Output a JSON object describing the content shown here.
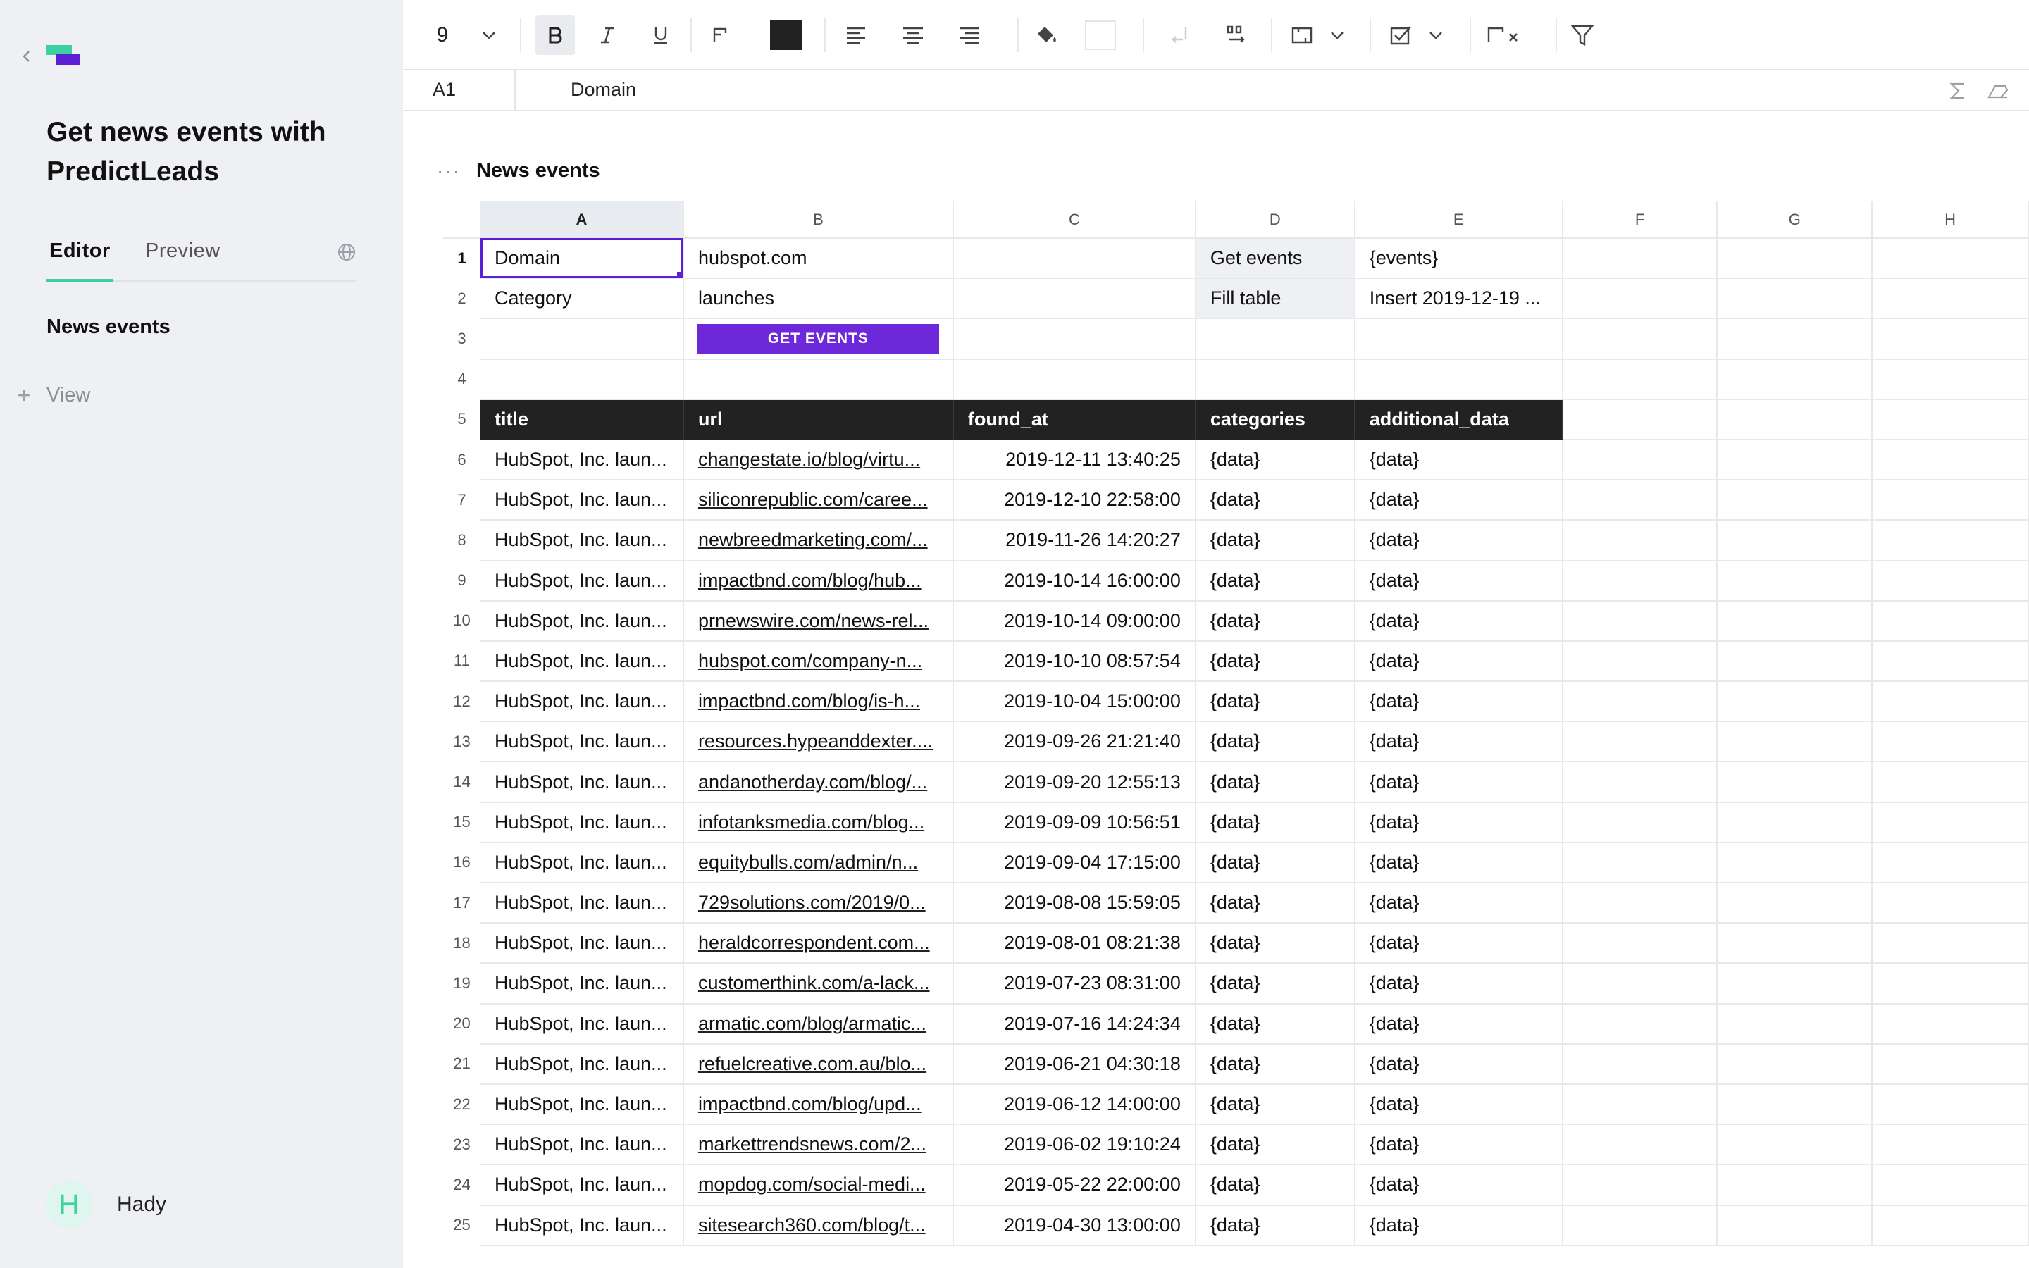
{
  "sidebar": {
    "title": "Get news events with PredictLeads",
    "tabs": [
      {
        "label": "Editor",
        "active": true
      },
      {
        "label": "Preview",
        "active": false
      }
    ],
    "items": [
      {
        "label": "News events"
      }
    ],
    "add_view_label": "View",
    "user": {
      "initial": "H",
      "name": "Hady"
    },
    "icons": [
      "back-chevron-icon",
      "app-logo",
      "globe-icon",
      "plus-icon"
    ]
  },
  "toolbar": {
    "font_size": "9",
    "icons": [
      "chevron-down-icon",
      "bold-icon",
      "italic-icon",
      "underline-icon",
      "text-color-icon",
      "align-left-icon",
      "align-center-icon",
      "align-right-icon",
      "fill-color-icon",
      "indent-icon",
      "outdent-icon",
      "format-icon",
      "checkbox-icon",
      "clear-format-icon",
      "filter-icon"
    ]
  },
  "formula_bar": {
    "cell_ref": "A1",
    "value": "Domain",
    "icons": [
      "sigma-icon",
      "eraser-icon"
    ]
  },
  "sheet": {
    "title": "News events",
    "column_headers": [
      "A",
      "B",
      "C",
      "D",
      "E",
      "F",
      "G",
      "H"
    ],
    "rows": {
      "r1": {
        "a": "Domain",
        "b": "hubspot.com",
        "d": "Get events",
        "e": "{events}"
      },
      "r2": {
        "a": "Category",
        "b": "launches",
        "d": "Fill table",
        "e": "Insert 2019-12-19 ..."
      },
      "r3": {
        "button": "GET EVENTS"
      }
    },
    "table_headers": [
      "title",
      "url",
      "found_at",
      "categories",
      "additional_data"
    ],
    "data_rows": [
      {
        "row": "6",
        "title": "HubSpot, Inc. laun...",
        "url": "changestate.io/blog/virtu...",
        "found_at": "2019-12-11 13:40:25",
        "categories": "{data}",
        "additional_data": "{data}"
      },
      {
        "row": "7",
        "title": "HubSpot, Inc. laun...",
        "url": "siliconrepublic.com/caree...",
        "found_at": "2019-12-10 22:58:00",
        "categories": "{data}",
        "additional_data": "{data}"
      },
      {
        "row": "8",
        "title": "HubSpot, Inc. laun...",
        "url": "newbreedmarketing.com/...",
        "found_at": "2019-11-26 14:20:27",
        "categories": "{data}",
        "additional_data": "{data}"
      },
      {
        "row": "9",
        "title": "HubSpot, Inc. laun...",
        "url": "impactbnd.com/blog/hub...",
        "found_at": "2019-10-14 16:00:00",
        "categories": "{data}",
        "additional_data": "{data}"
      },
      {
        "row": "10",
        "title": "HubSpot, Inc. laun...",
        "url": "prnewswire.com/news-rel...",
        "found_at": "2019-10-14 09:00:00",
        "categories": "{data}",
        "additional_data": "{data}"
      },
      {
        "row": "11",
        "title": "HubSpot, Inc. laun...",
        "url": "hubspot.com/company-n...",
        "found_at": "2019-10-10 08:57:54",
        "categories": "{data}",
        "additional_data": "{data}"
      },
      {
        "row": "12",
        "title": "HubSpot, Inc. laun...",
        "url": "impactbnd.com/blog/is-h...",
        "found_at": "2019-10-04 15:00:00",
        "categories": "{data}",
        "additional_data": "{data}"
      },
      {
        "row": "13",
        "title": "HubSpot, Inc. laun...",
        "url": "resources.hypeanddexter....",
        "found_at": "2019-09-26 21:21:40",
        "categories": "{data}",
        "additional_data": "{data}"
      },
      {
        "row": "14",
        "title": "HubSpot, Inc. laun...",
        "url": "andanotherday.com/blog/...",
        "found_at": "2019-09-20 12:55:13",
        "categories": "{data}",
        "additional_data": "{data}"
      },
      {
        "row": "15",
        "title": "HubSpot, Inc. laun...",
        "url": "infotanksmedia.com/blog...",
        "found_at": "2019-09-09 10:56:51",
        "categories": "{data}",
        "additional_data": "{data}"
      },
      {
        "row": "16",
        "title": "HubSpot, Inc. laun...",
        "url": "equitybulls.com/admin/n...",
        "found_at": "2019-09-04 17:15:00",
        "categories": "{data}",
        "additional_data": "{data}"
      },
      {
        "row": "17",
        "title": "HubSpot, Inc. laun...",
        "url": "729solutions.com/2019/0...",
        "found_at": "2019-08-08 15:59:05",
        "categories": "{data}",
        "additional_data": "{data}"
      },
      {
        "row": "18",
        "title": "HubSpot, Inc. laun...",
        "url": "heraldcorrespondent.com...",
        "found_at": "2019-08-01 08:21:38",
        "categories": "{data}",
        "additional_data": "{data}"
      },
      {
        "row": "19",
        "title": "HubSpot, Inc. laun...",
        "url": "customerthink.com/a-lack...",
        "found_at": "2019-07-23 08:31:00",
        "categories": "{data}",
        "additional_data": "{data}"
      },
      {
        "row": "20",
        "title": "HubSpot, Inc. laun...",
        "url": "armatic.com/blog/armatic...",
        "found_at": "2019-07-16 14:24:34",
        "categories": "{data}",
        "additional_data": "{data}"
      },
      {
        "row": "21",
        "title": "HubSpot, Inc. laun...",
        "url": "refuelcreative.com.au/blo...",
        "found_at": "2019-06-21 04:30:18",
        "categories": "{data}",
        "additional_data": "{data}"
      },
      {
        "row": "22",
        "title": "HubSpot, Inc. laun...",
        "url": "impactbnd.com/blog/upd...",
        "found_at": "2019-06-12 14:00:00",
        "categories": "{data}",
        "additional_data": "{data}"
      },
      {
        "row": "23",
        "title": "HubSpot, Inc. laun...",
        "url": "markettrendsnews.com/2...",
        "found_at": "2019-06-02 19:10:24",
        "categories": "{data}",
        "additional_data": "{data}"
      },
      {
        "row": "24",
        "title": "HubSpot, Inc. laun...",
        "url": "mopdog.com/social-medi...",
        "found_at": "2019-05-22 22:00:00",
        "categories": "{data}",
        "additional_data": "{data}"
      },
      {
        "row": "25",
        "title": "HubSpot, Inc. laun...",
        "url": "sitesearch360.com/blog/t...",
        "found_at": "2019-04-30 13:00:00",
        "categories": "{data}",
        "additional_data": "{data}"
      }
    ]
  },
  "colors": {
    "accent": "#3ecfa3",
    "brand_purple": "#5b1fd6",
    "button_purple": "#6d28d9",
    "header_dark": "#222222",
    "sidebar_bg": "#eef0f3"
  }
}
